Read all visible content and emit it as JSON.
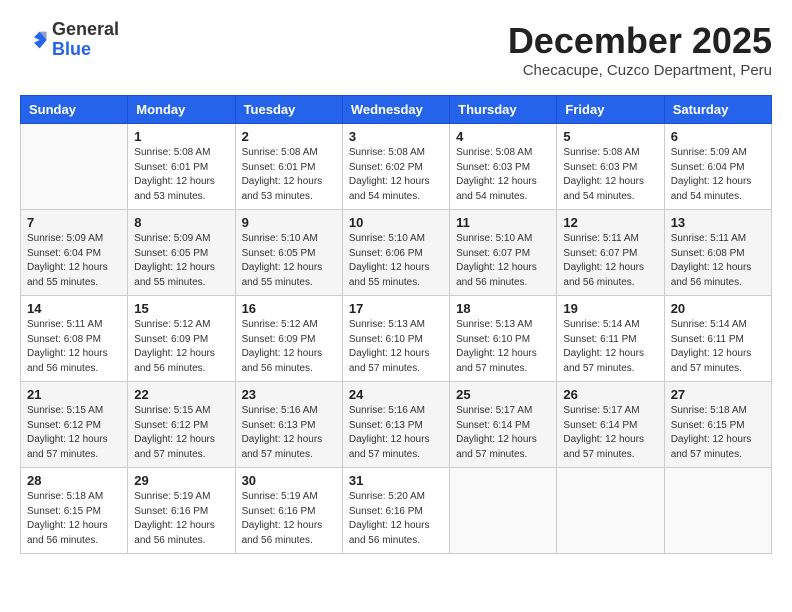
{
  "header": {
    "logo_general": "General",
    "logo_blue": "Blue",
    "month_title": "December 2025",
    "location": "Checacupe, Cuzco Department, Peru"
  },
  "days_of_week": [
    "Sunday",
    "Monday",
    "Tuesday",
    "Wednesday",
    "Thursday",
    "Friday",
    "Saturday"
  ],
  "weeks": [
    [
      {
        "day": "",
        "info": ""
      },
      {
        "day": "1",
        "info": "Sunrise: 5:08 AM\nSunset: 6:01 PM\nDaylight: 12 hours\nand 53 minutes."
      },
      {
        "day": "2",
        "info": "Sunrise: 5:08 AM\nSunset: 6:01 PM\nDaylight: 12 hours\nand 53 minutes."
      },
      {
        "day": "3",
        "info": "Sunrise: 5:08 AM\nSunset: 6:02 PM\nDaylight: 12 hours\nand 54 minutes."
      },
      {
        "day": "4",
        "info": "Sunrise: 5:08 AM\nSunset: 6:03 PM\nDaylight: 12 hours\nand 54 minutes."
      },
      {
        "day": "5",
        "info": "Sunrise: 5:08 AM\nSunset: 6:03 PM\nDaylight: 12 hours\nand 54 minutes."
      },
      {
        "day": "6",
        "info": "Sunrise: 5:09 AM\nSunset: 6:04 PM\nDaylight: 12 hours\nand 54 minutes."
      }
    ],
    [
      {
        "day": "7",
        "info": "Sunrise: 5:09 AM\nSunset: 6:04 PM\nDaylight: 12 hours\nand 55 minutes."
      },
      {
        "day": "8",
        "info": "Sunrise: 5:09 AM\nSunset: 6:05 PM\nDaylight: 12 hours\nand 55 minutes."
      },
      {
        "day": "9",
        "info": "Sunrise: 5:10 AM\nSunset: 6:05 PM\nDaylight: 12 hours\nand 55 minutes."
      },
      {
        "day": "10",
        "info": "Sunrise: 5:10 AM\nSunset: 6:06 PM\nDaylight: 12 hours\nand 55 minutes."
      },
      {
        "day": "11",
        "info": "Sunrise: 5:10 AM\nSunset: 6:07 PM\nDaylight: 12 hours\nand 56 minutes."
      },
      {
        "day": "12",
        "info": "Sunrise: 5:11 AM\nSunset: 6:07 PM\nDaylight: 12 hours\nand 56 minutes."
      },
      {
        "day": "13",
        "info": "Sunrise: 5:11 AM\nSunset: 6:08 PM\nDaylight: 12 hours\nand 56 minutes."
      }
    ],
    [
      {
        "day": "14",
        "info": "Sunrise: 5:11 AM\nSunset: 6:08 PM\nDaylight: 12 hours\nand 56 minutes."
      },
      {
        "day": "15",
        "info": "Sunrise: 5:12 AM\nSunset: 6:09 PM\nDaylight: 12 hours\nand 56 minutes."
      },
      {
        "day": "16",
        "info": "Sunrise: 5:12 AM\nSunset: 6:09 PM\nDaylight: 12 hours\nand 56 minutes."
      },
      {
        "day": "17",
        "info": "Sunrise: 5:13 AM\nSunset: 6:10 PM\nDaylight: 12 hours\nand 57 minutes."
      },
      {
        "day": "18",
        "info": "Sunrise: 5:13 AM\nSunset: 6:10 PM\nDaylight: 12 hours\nand 57 minutes."
      },
      {
        "day": "19",
        "info": "Sunrise: 5:14 AM\nSunset: 6:11 PM\nDaylight: 12 hours\nand 57 minutes."
      },
      {
        "day": "20",
        "info": "Sunrise: 5:14 AM\nSunset: 6:11 PM\nDaylight: 12 hours\nand 57 minutes."
      }
    ],
    [
      {
        "day": "21",
        "info": "Sunrise: 5:15 AM\nSunset: 6:12 PM\nDaylight: 12 hours\nand 57 minutes."
      },
      {
        "day": "22",
        "info": "Sunrise: 5:15 AM\nSunset: 6:12 PM\nDaylight: 12 hours\nand 57 minutes."
      },
      {
        "day": "23",
        "info": "Sunrise: 5:16 AM\nSunset: 6:13 PM\nDaylight: 12 hours\nand 57 minutes."
      },
      {
        "day": "24",
        "info": "Sunrise: 5:16 AM\nSunset: 6:13 PM\nDaylight: 12 hours\nand 57 minutes."
      },
      {
        "day": "25",
        "info": "Sunrise: 5:17 AM\nSunset: 6:14 PM\nDaylight: 12 hours\nand 57 minutes."
      },
      {
        "day": "26",
        "info": "Sunrise: 5:17 AM\nSunset: 6:14 PM\nDaylight: 12 hours\nand 57 minutes."
      },
      {
        "day": "27",
        "info": "Sunrise: 5:18 AM\nSunset: 6:15 PM\nDaylight: 12 hours\nand 57 minutes."
      }
    ],
    [
      {
        "day": "28",
        "info": "Sunrise: 5:18 AM\nSunset: 6:15 PM\nDaylight: 12 hours\nand 56 minutes."
      },
      {
        "day": "29",
        "info": "Sunrise: 5:19 AM\nSunset: 6:16 PM\nDaylight: 12 hours\nand 56 minutes."
      },
      {
        "day": "30",
        "info": "Sunrise: 5:19 AM\nSunset: 6:16 PM\nDaylight: 12 hours\nand 56 minutes."
      },
      {
        "day": "31",
        "info": "Sunrise: 5:20 AM\nSunset: 6:16 PM\nDaylight: 12 hours\nand 56 minutes."
      },
      {
        "day": "",
        "info": ""
      },
      {
        "day": "",
        "info": ""
      },
      {
        "day": "",
        "info": ""
      }
    ]
  ]
}
